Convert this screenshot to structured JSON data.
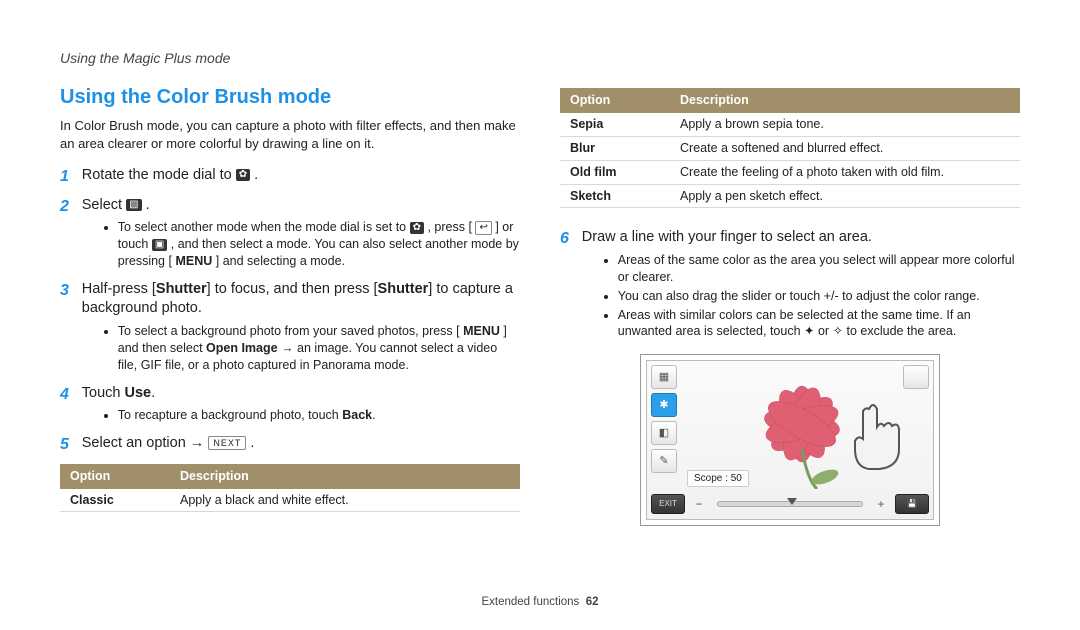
{
  "breadcrumb": "Using the Magic Plus mode",
  "heading": "Using the Color Brush mode",
  "intro": "In Color Brush mode, you can capture a photo with filter effects, and then make an area clearer or more colorful by drawing a line on it.",
  "steps": {
    "s1": {
      "num": "1",
      "lead_a": "Rotate the mode dial to ",
      "lead_b": "."
    },
    "s2": {
      "num": "2",
      "lead_a": "Select ",
      "lead_b": ".",
      "sub1a": "To select another mode when the mode dial is set to ",
      "sub1b": ", press [",
      "sub1c": "] or touch ",
      "sub1d": ", and then select a mode. You can also select another mode by pressing [",
      "sub1e": "] and selecting a mode."
    },
    "s3": {
      "num": "3",
      "lead_a": "Half-press [",
      "lead_b": "] to focus, and then press [",
      "lead_c": "] to capture a background photo.",
      "shutter": "Shutter",
      "sub1a": "To select a background photo from your saved photos, press [",
      "sub1b": "] and then select ",
      "open_image": "Open Image",
      "sub1c": " → an image. You cannot select a video file, GIF file, or a photo captured in Panorama mode."
    },
    "s4": {
      "num": "4",
      "lead_a": "Touch ",
      "use": "Use",
      "lead_b": ".",
      "sub1a": "To recapture a background photo, touch ",
      "back": "Back",
      "sub1b": "."
    },
    "s5": {
      "num": "5",
      "lead_a": "Select an option → ",
      "next_pill": "NEXT",
      "lead_b": "."
    },
    "s6": {
      "num": "6",
      "lead": "Draw a line with your finger to select an area.",
      "sub1": "Areas of the same color as the area you select will appear more colorful or clearer.",
      "sub2": "You can also drag the slider or touch +/- to adjust the color range.",
      "sub3a": "Areas with similar colors can be selected at the same time. If an unwanted area is selected, touch ",
      "sub3b": " or ",
      "sub3c": " to exclude the area."
    }
  },
  "icons": {
    "menu": "MENU",
    "mode_dial": "✿",
    "select": "▧",
    "back_arrow": "↩",
    "touch": "▣",
    "brush_ex1": "✦",
    "brush_ex2": "✧"
  },
  "table_left": {
    "hdr_option": "Option",
    "hdr_desc": "Description",
    "rows": [
      {
        "opt": "Classic",
        "desc": "Apply a black and white effect."
      }
    ]
  },
  "table_right": {
    "hdr_option": "Option",
    "hdr_desc": "Description",
    "rows": [
      {
        "opt": "Sepia",
        "desc": "Apply a brown sepia tone."
      },
      {
        "opt": "Blur",
        "desc": "Create a softened and blurred effect."
      },
      {
        "opt": "Old film",
        "desc": "Create the feeling of a photo taken with old film."
      },
      {
        "opt": "Sketch",
        "desc": "Apply a pen sketch effect."
      }
    ]
  },
  "screenshot": {
    "scope_label": "Scope : 50",
    "exit": "EXIT",
    "save": "💾"
  },
  "footer": {
    "section": "Extended functions",
    "page": "62"
  }
}
